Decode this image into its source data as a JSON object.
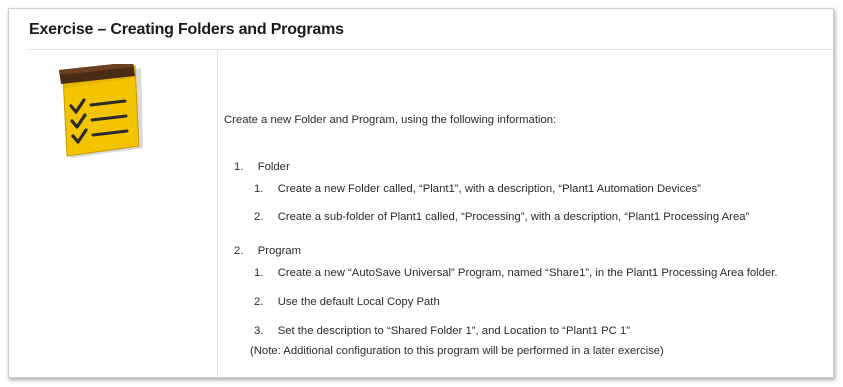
{
  "title": "Exercise – Creating Folders and Programs",
  "intro": "Create a new Folder and Program, using the following information:",
  "sections": [
    {
      "number": "1.",
      "label": "Folder",
      "items": [
        {
          "number": "1.",
          "text": "Create a new Folder called, “Plant1”, with a description, “Plant1 Automation Devices”"
        },
        {
          "number": "2.",
          "text": "Create a sub-folder of Plant1 called, “Processing”, with a description, “Plant1 Processing Area”"
        }
      ]
    },
    {
      "number": "2.",
      "label": "Program",
      "items": [
        {
          "number": "1.",
          "text": "Create a new “AutoSave Universal” Program, named “Share1”, in the Plant1 Processing Area folder."
        },
        {
          "number": "2.",
          "text": "Use the default Local Copy Path"
        },
        {
          "number": "3.",
          "text": "Set the description to “Shared Folder 1”, and Location to “Plant1 PC 1”"
        }
      ]
    }
  ],
  "note": "(Note: Additional configuration to this program will be performed in a later exercise)",
  "icons": {
    "notepad": "checklist-notepad-icon"
  },
  "colors": {
    "notepad_body": "#f2c500",
    "notepad_top": "#4a2b18",
    "check": "#2b2b2b"
  }
}
